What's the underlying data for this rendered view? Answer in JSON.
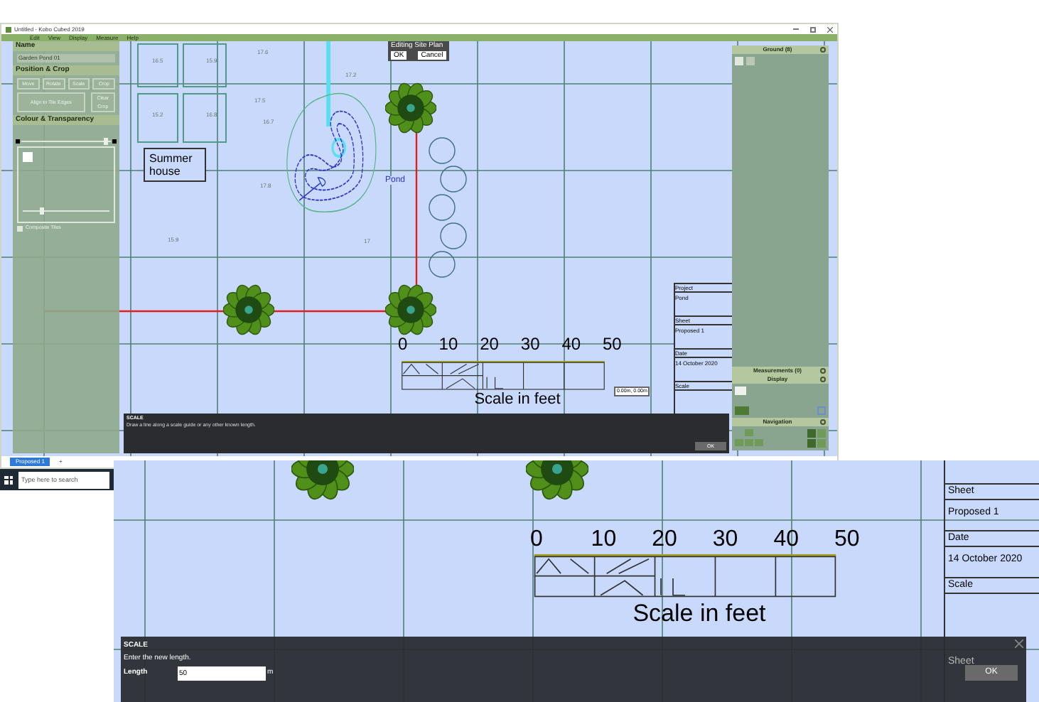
{
  "window": {
    "title": "Untitled - Kobo Cubed 2019"
  },
  "menu": [
    "Edit",
    "View",
    "Display",
    "Measure",
    "Help"
  ],
  "left_panel": {
    "name_heading": "Name",
    "name_value": "Garden Pond 01",
    "position_heading": "Position & Crop",
    "position_buttons": [
      "Move",
      "Rotate",
      "Scale",
      "Crop"
    ],
    "position_wide_buttons": [
      "Align to Tile Edges",
      "Clear Crop"
    ],
    "colour_heading": "Colour & Transparency",
    "transparency": {
      "level": 0.92
    },
    "tint": {
      "level": 0.2
    },
    "composite": {
      "label": "Composite Tiles",
      "checked": false
    }
  },
  "canvas": {
    "spot_heights": [
      "16.5",
      "15.9",
      "15.2",
      "16.8",
      "17.6",
      "17.5",
      "17.2",
      "16.7",
      "17.8",
      "15.9",
      "17"
    ],
    "summer_house": "Summer house",
    "pond": "Pond",
    "edit_popup": {
      "title": "Editing Site Plan",
      "buttons": [
        "OK",
        "Cancel"
      ]
    },
    "scale_bar": {
      "ticks": [
        "0",
        "10",
        "20",
        "30",
        "40",
        "50"
      ],
      "caption": "Scale in feet"
    },
    "coordinate_tip": "0.00m, 0.00m"
  },
  "title_block": [
    {
      "label": "Project",
      "value": "Pond"
    },
    {
      "label": "Sheet",
      "value": "Proposed 1"
    },
    {
      "label": "Date",
      "value": "14 October 2020"
    },
    {
      "label": "Scale"
    }
  ],
  "right_panel": {
    "ground": {
      "title": "Ground (8)"
    },
    "measurements": {
      "title": "Measurements (0)"
    },
    "display": {
      "title": "Display"
    },
    "navigation": {
      "title": "Navigation"
    }
  },
  "scale_prompt": {
    "title": "SCALE",
    "message": "Draw a line along a scale guide or any other known length.",
    "button": "OK"
  },
  "sheet_tabs": [
    {
      "label": "Proposed 1",
      "selected": true
    },
    {
      "label": "+",
      "selected": false
    }
  ],
  "taskbar": {
    "search_placeholder": "Type here to search"
  },
  "zoomed_view": {
    "scale_bar": {
      "ticks": [
        "0",
        "10",
        "20",
        "30",
        "40",
        "50"
      ],
      "caption": "Scale in feet"
    },
    "title_block": [
      {
        "label": "Sheet",
        "value": "Proposed 1"
      },
      {
        "label": "Date",
        "value": "14 October 2020"
      },
      {
        "label": "Scale"
      }
    ],
    "hidden_label": "Sheet",
    "scale_prompt": {
      "title": "SCALE",
      "message": "Enter the new length.",
      "field_label": "Length",
      "field_value": "50",
      "unit": "m",
      "button": "OK"
    }
  }
}
